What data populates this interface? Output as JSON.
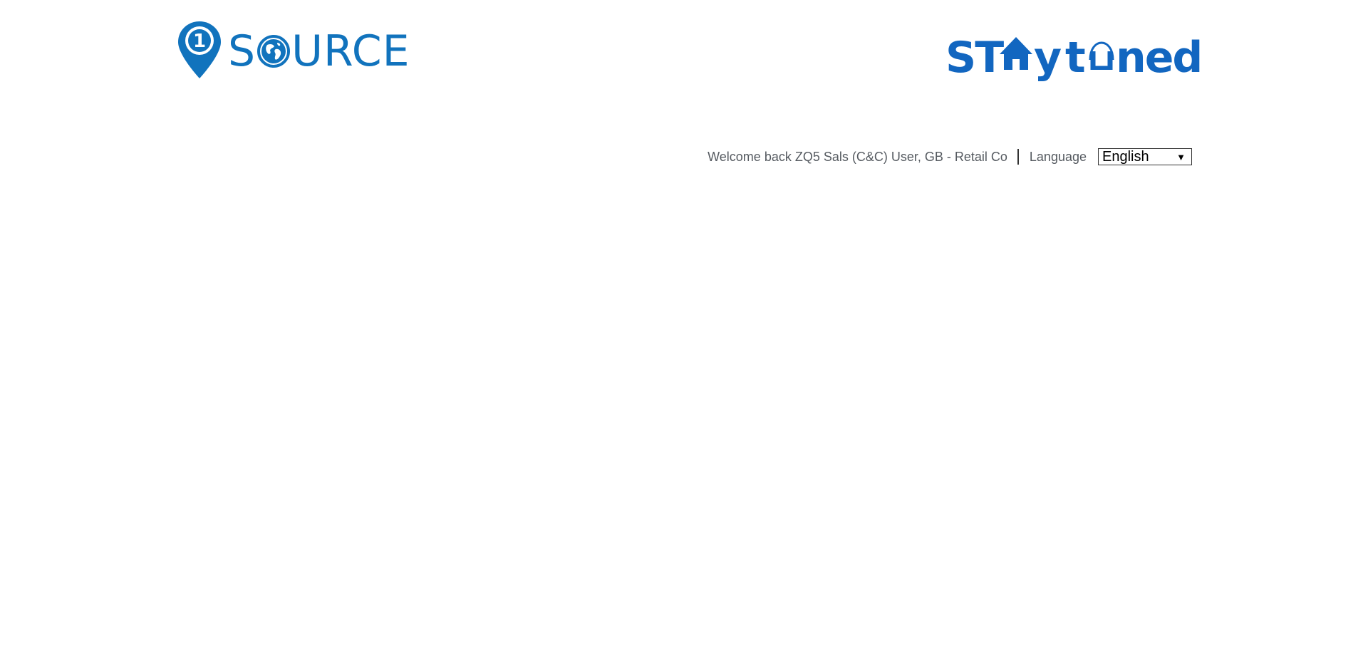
{
  "header": {
    "brand_logo": {
      "numeral": "1",
      "text_before_globe": "S",
      "text_after_globe": "URCE",
      "color": "#1173bd"
    },
    "campaign_logo": {
      "text_st": "ST",
      "text_y": "y",
      "text_tuned_t": "t",
      "text_tuned_rest": "ned",
      "color": "#1266c0"
    }
  },
  "userbar": {
    "welcome": "Welcome back ZQ5 Sals (C&C) User, GB - Retail Co",
    "language_label": "Language",
    "language_selected": "English",
    "dropdown_arrow": "▼"
  }
}
